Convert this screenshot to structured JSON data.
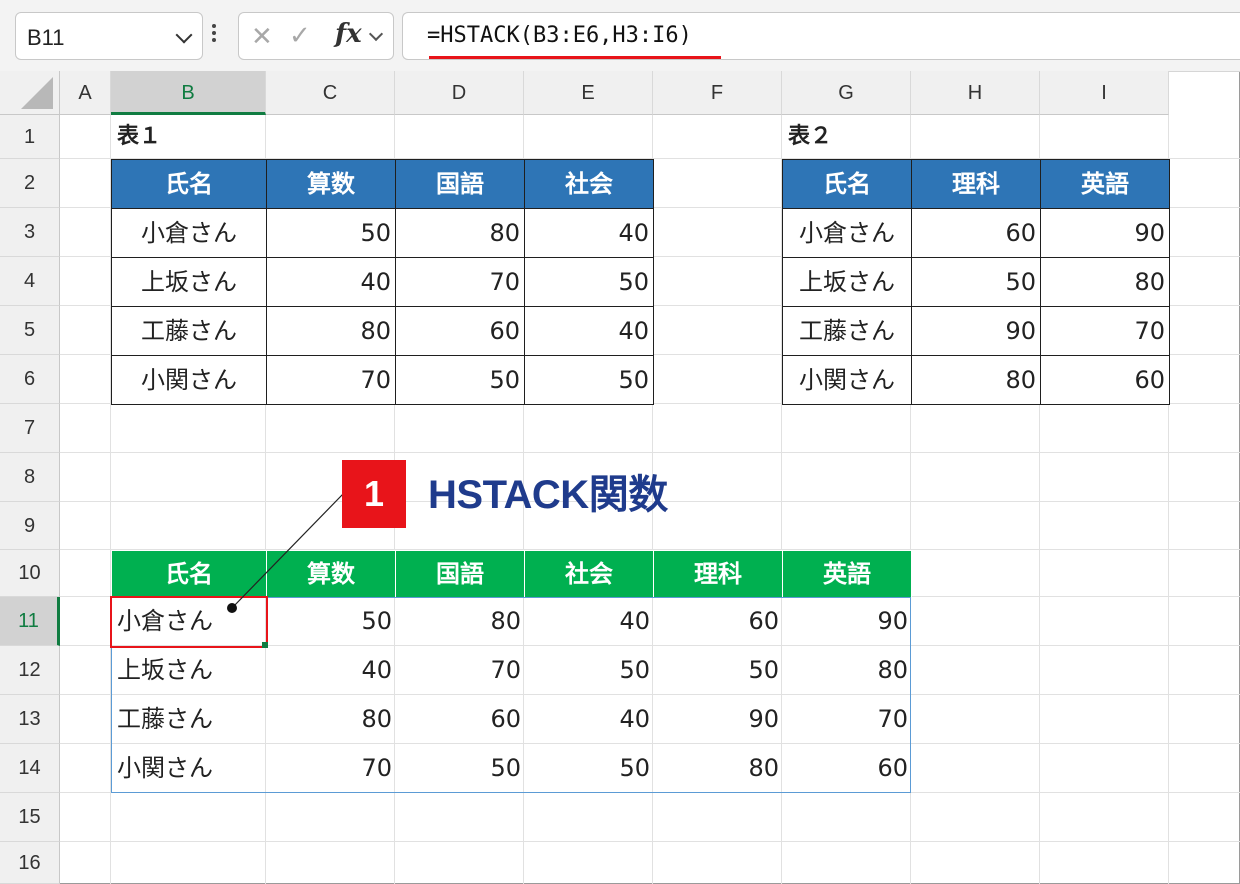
{
  "formula_bar": {
    "name_box": "B11",
    "cancel_glyph": "✕",
    "enter_glyph": "✓",
    "fx_label": "fx",
    "formula": "=HSTACK(B3:E6,H3:I6)"
  },
  "columns": [
    "A",
    "B",
    "C",
    "D",
    "E",
    "F",
    "G",
    "H",
    "I"
  ],
  "rows": [
    "1",
    "2",
    "3",
    "4",
    "5",
    "6",
    "7",
    "8",
    "9",
    "10",
    "11",
    "12",
    "13",
    "14",
    "15",
    "16"
  ],
  "selected": {
    "column": "B",
    "row": "11"
  },
  "table1": {
    "title": "表１",
    "headers": [
      "氏名",
      "算数",
      "国語",
      "社会"
    ],
    "rows": [
      [
        "小倉さん",
        "50",
        "80",
        "40"
      ],
      [
        "上坂さん",
        "40",
        "70",
        "50"
      ],
      [
        "工藤さん",
        "80",
        "60",
        "40"
      ],
      [
        "小関さん",
        "70",
        "50",
        "50"
      ]
    ]
  },
  "table2": {
    "title": "表２",
    "headers": [
      "氏名",
      "理科",
      "英語"
    ],
    "rows": [
      [
        "小倉さん",
        "60",
        "90"
      ],
      [
        "上坂さん",
        "50",
        "80"
      ],
      [
        "工藤さん",
        "90",
        "70"
      ],
      [
        "小関さん",
        "80",
        "60"
      ]
    ]
  },
  "result": {
    "headers": [
      "氏名",
      "算数",
      "国語",
      "社会",
      "理科",
      "英語"
    ],
    "rows": [
      [
        "小倉さん",
        "50",
        "80",
        "40",
        "60",
        "90"
      ],
      [
        "上坂さん",
        "40",
        "70",
        "50",
        "50",
        "80"
      ],
      [
        "工藤さん",
        "80",
        "60",
        "40",
        "90",
        "70"
      ],
      [
        "小関さん",
        "70",
        "50",
        "50",
        "80",
        "60"
      ]
    ]
  },
  "callout": {
    "number": "1",
    "label": "HSTACK関数"
  },
  "colors": {
    "table1_header": "#2e75b6",
    "result_header": "#00b050",
    "callout": "#e8141a",
    "callout_text": "#1f3b8c",
    "selection": "#107c41"
  }
}
